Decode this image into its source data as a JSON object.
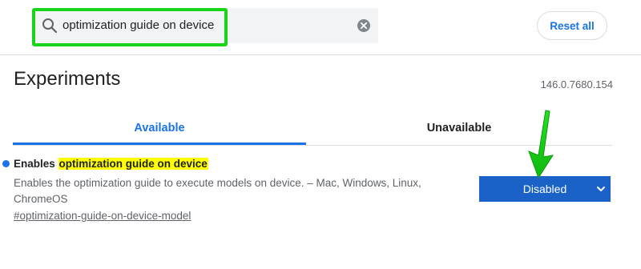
{
  "search": {
    "value": "optimization guide on device"
  },
  "header": {
    "reset_label": "Reset all"
  },
  "page": {
    "title": "Experiments",
    "version": "146.0.7680.154"
  },
  "tabs": [
    {
      "label": "Available",
      "selected": true
    },
    {
      "label": "Unavailable",
      "selected": false
    }
  ],
  "experiment": {
    "title_prefix": "Enables ",
    "title_highlight": "optimization guide on device",
    "description_line1": "Enables the optimization guide to execute models on device. – Mac, Windows, Linux,",
    "description_line2": "ChromeOS",
    "link": "#optimization-guide-on-device-model",
    "select_value": "Disabled"
  },
  "colors": {
    "accent": "#1a73e8",
    "select_bg": "#1a62c8",
    "highlight": "#ffff00",
    "annotation_green": "#19d419"
  },
  "icons": {
    "search": "search-icon",
    "clear": "clear-icon",
    "chevron": "chevron-down-icon",
    "arrow": "annotation-arrow"
  }
}
